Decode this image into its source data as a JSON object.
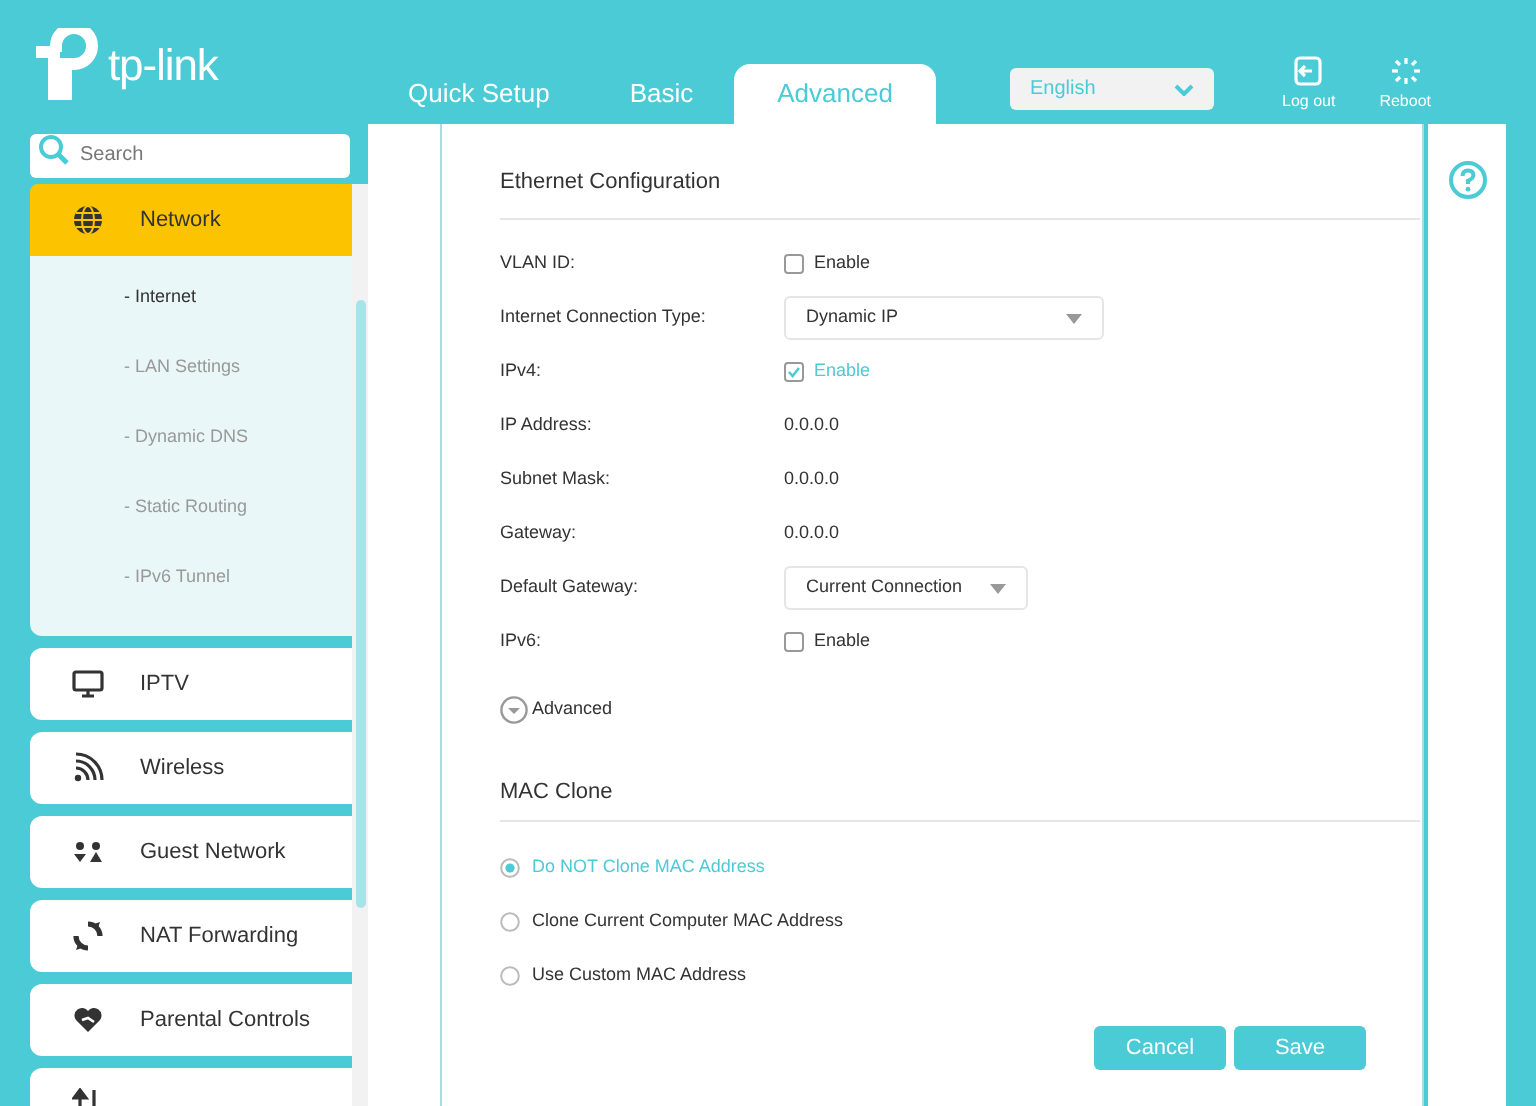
{
  "header": {
    "logo_text": "tp-link",
    "tabs": [
      {
        "label": "Quick Setup",
        "selected": false
      },
      {
        "label": "Basic",
        "selected": false
      },
      {
        "label": "Advanced",
        "selected": true
      }
    ],
    "language": "English",
    "actions": [
      {
        "label": "Log out",
        "kind": "logout"
      },
      {
        "label": "Reboot",
        "kind": "reboot"
      }
    ]
  },
  "sidebar": {
    "search": {
      "placeholder": "Search"
    },
    "items": [
      {
        "label": "Network",
        "kind": "globe",
        "selected": true,
        "expanded": true,
        "children": [
          {
            "label": "- Internet",
            "selected": true
          },
          {
            "label": "- LAN Settings",
            "selected": false
          },
          {
            "label": "- Dynamic DNS",
            "selected": false
          },
          {
            "label": "- Static Routing",
            "selected": false
          },
          {
            "label": "- IPv6 Tunnel",
            "selected": false
          }
        ]
      },
      {
        "label": "IPTV",
        "kind": "monitor",
        "selected": false,
        "expanded": false
      },
      {
        "label": "Wireless",
        "kind": "wifi",
        "selected": false,
        "expanded": false
      },
      {
        "label": "Guest Network",
        "kind": "guests",
        "selected": false,
        "expanded": false
      },
      {
        "label": "NAT Forwarding",
        "kind": "nat",
        "selected": false,
        "expanded": false
      },
      {
        "label": "Parental Controls",
        "kind": "heart",
        "selected": false,
        "expanded": false
      },
      {
        "kind": "qos",
        "selected": false,
        "expanded": false
      }
    ]
  },
  "ethernet": {
    "title": "Ethernet Configuration",
    "rows": [
      {
        "label": "VLAN ID:",
        "kind": "checkbox",
        "text": "Enable",
        "checked": false
      },
      {
        "label": "Internet Connection Type:",
        "kind": "select",
        "value": "Dynamic IP"
      },
      {
        "label": "IPv4:",
        "kind": "checkbox",
        "text": "Enable",
        "checked": true
      },
      {
        "label": "IP Address:",
        "kind": "text",
        "value": "0.0.0.0"
      },
      {
        "label": "Subnet Mask:",
        "kind": "text",
        "value": "0.0.0.0"
      },
      {
        "label": "Gateway:",
        "kind": "text",
        "value": "0.0.0.0"
      },
      {
        "label": "Default Gateway:",
        "kind": "select",
        "value": "Current Connection"
      },
      {
        "label": "IPv6:",
        "kind": "checkbox",
        "text": "Enable",
        "checked": false
      }
    ],
    "advanced_toggle": "Advanced"
  },
  "mac_clone": {
    "title": "MAC Clone",
    "options": [
      {
        "label": "Do NOT Clone MAC Address",
        "selected": true
      },
      {
        "label": "Clone Current Computer MAC Address",
        "selected": false
      },
      {
        "label": "Use Custom MAC Address",
        "selected": false
      }
    ]
  },
  "buttons": [
    "Cancel",
    "Save"
  ]
}
